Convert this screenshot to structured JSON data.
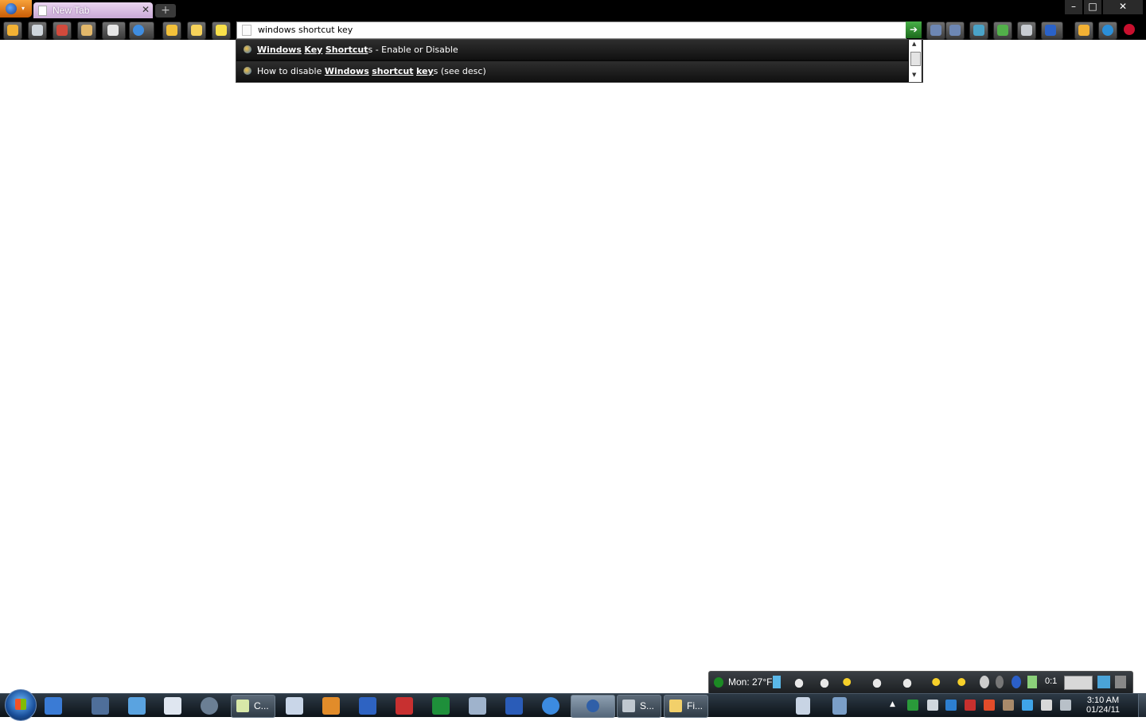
{
  "window": {
    "tab_title": "New Tab",
    "tab_close": "✕",
    "new_tab": "+",
    "minimize": "–",
    "maximize": "□",
    "close": "✕",
    "menu_caret": "▾"
  },
  "toolbar": {
    "buttons": [
      "home-icon",
      "print-icon",
      "back-red-icon",
      "forward-icon",
      "alarm-icon",
      "reload-icon",
      "bookmark-add-icon",
      "bookmarks-icon",
      "star-icon"
    ],
    "url_value": "windows shortcut key",
    "go": "➔",
    "right_buttons": [
      "back-icon",
      "forward-icon",
      "screenshot-icon",
      "addon-icon",
      "page-icon",
      "save-icon",
      "lock-icon",
      "sync-icon",
      "flag-icon"
    ]
  },
  "autocomplete": {
    "items": [
      {
        "parts": [
          {
            "t": "Windows",
            "b": true
          },
          {
            "t": " ",
            "b": false
          },
          {
            "t": "Key",
            "b": true
          },
          {
            "t": " ",
            "b": false
          },
          {
            "t": "Shortcut",
            "b": true
          },
          {
            "t": "s - Enable or Disable",
            "b": false
          }
        ]
      },
      {
        "parts": [
          {
            "t": "How to disable ",
            "b": false
          },
          {
            "t": "Windows",
            "b": true
          },
          {
            "t": " ",
            "b": false
          },
          {
            "t": "shortcut",
            "b": true
          },
          {
            "t": " ",
            "b": false
          },
          {
            "t": "key",
            "b": true
          },
          {
            "t": "s (see desc)",
            "b": false
          }
        ]
      }
    ],
    "scroll_up": "▲",
    "scroll_down": "▼"
  },
  "gadget": {
    "weather_text": "Mon: 27°F",
    "count": "0:1"
  },
  "taskbar": {
    "buttons": [
      {
        "label": "C...",
        "name": "taskbar-notepad"
      },
      {
        "label": "S...",
        "name": "taskbar-s-app"
      },
      {
        "label": "Fi...",
        "name": "taskbar-file-explorer"
      }
    ],
    "tray_caret": "▲",
    "clock_time": "3:10 AM",
    "clock_date": "01/24/11"
  },
  "colors": {
    "accent_tab": "#c9a9d6",
    "go_button": "#2e8f2e",
    "taskbar": "#1a242e"
  }
}
